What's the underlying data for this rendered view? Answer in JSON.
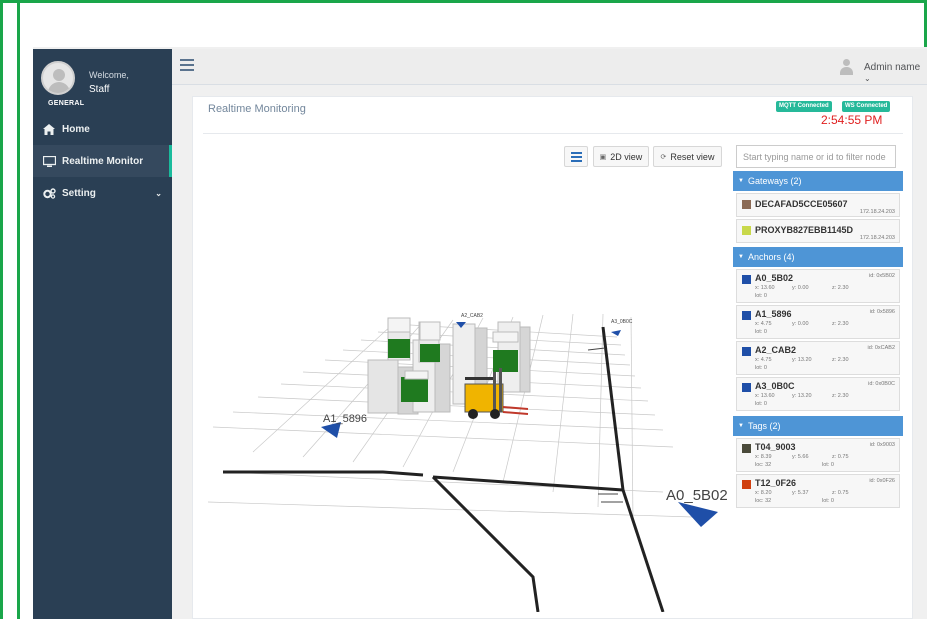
{
  "sidebar": {
    "welcome": "Welcome,",
    "user": "Staff",
    "section": "GENERAL",
    "items": [
      {
        "label": "Home",
        "icon": "home-icon"
      },
      {
        "label": "Realtime Monitor",
        "icon": "monitor-icon"
      },
      {
        "label": "Setting",
        "icon": "gears-icon"
      }
    ]
  },
  "topnav": {
    "admin_name": "Admin name"
  },
  "panel": {
    "title": "Realtime Monitoring",
    "mqtt": "MQTT Connected",
    "ws": "WS Connected",
    "clock": "2:54:55 PM",
    "btn_2d": "2D view",
    "btn_reset": "Reset view",
    "filter_placeholder": "Start typing name or id to filter node"
  },
  "gateways": {
    "header": "Gateways (2)",
    "items": [
      {
        "name": "DECAFAD5CCE05607",
        "ip": "172.18.24.203",
        "color": "#8b6a55"
      },
      {
        "name": "PROXYB827EBB1145D",
        "ip": "172.18.24.203",
        "color": "#c8d84a"
      }
    ]
  },
  "anchors": {
    "header": "Anchors (4)",
    "items": [
      {
        "name": "A0_5B02",
        "id": "id: 0x5B02",
        "x": "x: 13.60",
        "y": "y: 0.00",
        "z": "z: 2.30",
        "lot": "lot: 0",
        "color": "#1f4fa8"
      },
      {
        "name": "A1_5896",
        "id": "id: 0x5896",
        "x": "x: 4.75",
        "y": "y: 0.00",
        "z": "z: 2.30",
        "lot": "lot: 0",
        "color": "#1f4fa8"
      },
      {
        "name": "A2_CAB2",
        "id": "id: 0xCAB2",
        "x": "x: 4.75",
        "y": "y: 13.20",
        "z": "z: 2.30",
        "lot": "lot: 0",
        "color": "#1f4fa8"
      },
      {
        "name": "A3_0B0C",
        "id": "id: 0x0B0C",
        "x": "x: 13.60",
        "y": "y: 13.20",
        "z": "z: 2.30",
        "lot": "lot: 0",
        "color": "#1f4fa8"
      }
    ]
  },
  "tags": {
    "header": "Tags (2)",
    "items": [
      {
        "name": "T04_9003",
        "id": "id: 0x9003",
        "x": "x: 8.39",
        "y": "y: 5.66",
        "z": "z: 0.75",
        "loc": "loc: 32",
        "lot": "lot: 0",
        "color": "#4a4a3a"
      },
      {
        "name": "T12_0F26",
        "id": "id: 0x0F26",
        "x": "x: 8.20",
        "y": "y: 5.37",
        "z": "z: 0.75",
        "loc": "loc: 32",
        "lot": "lot: 0",
        "color": "#d04010"
      }
    ]
  },
  "scene": {
    "anchor_labels": [
      "A0_5B02",
      "A1_5896",
      "A2_CAB2",
      "A3_0B0C"
    ]
  }
}
